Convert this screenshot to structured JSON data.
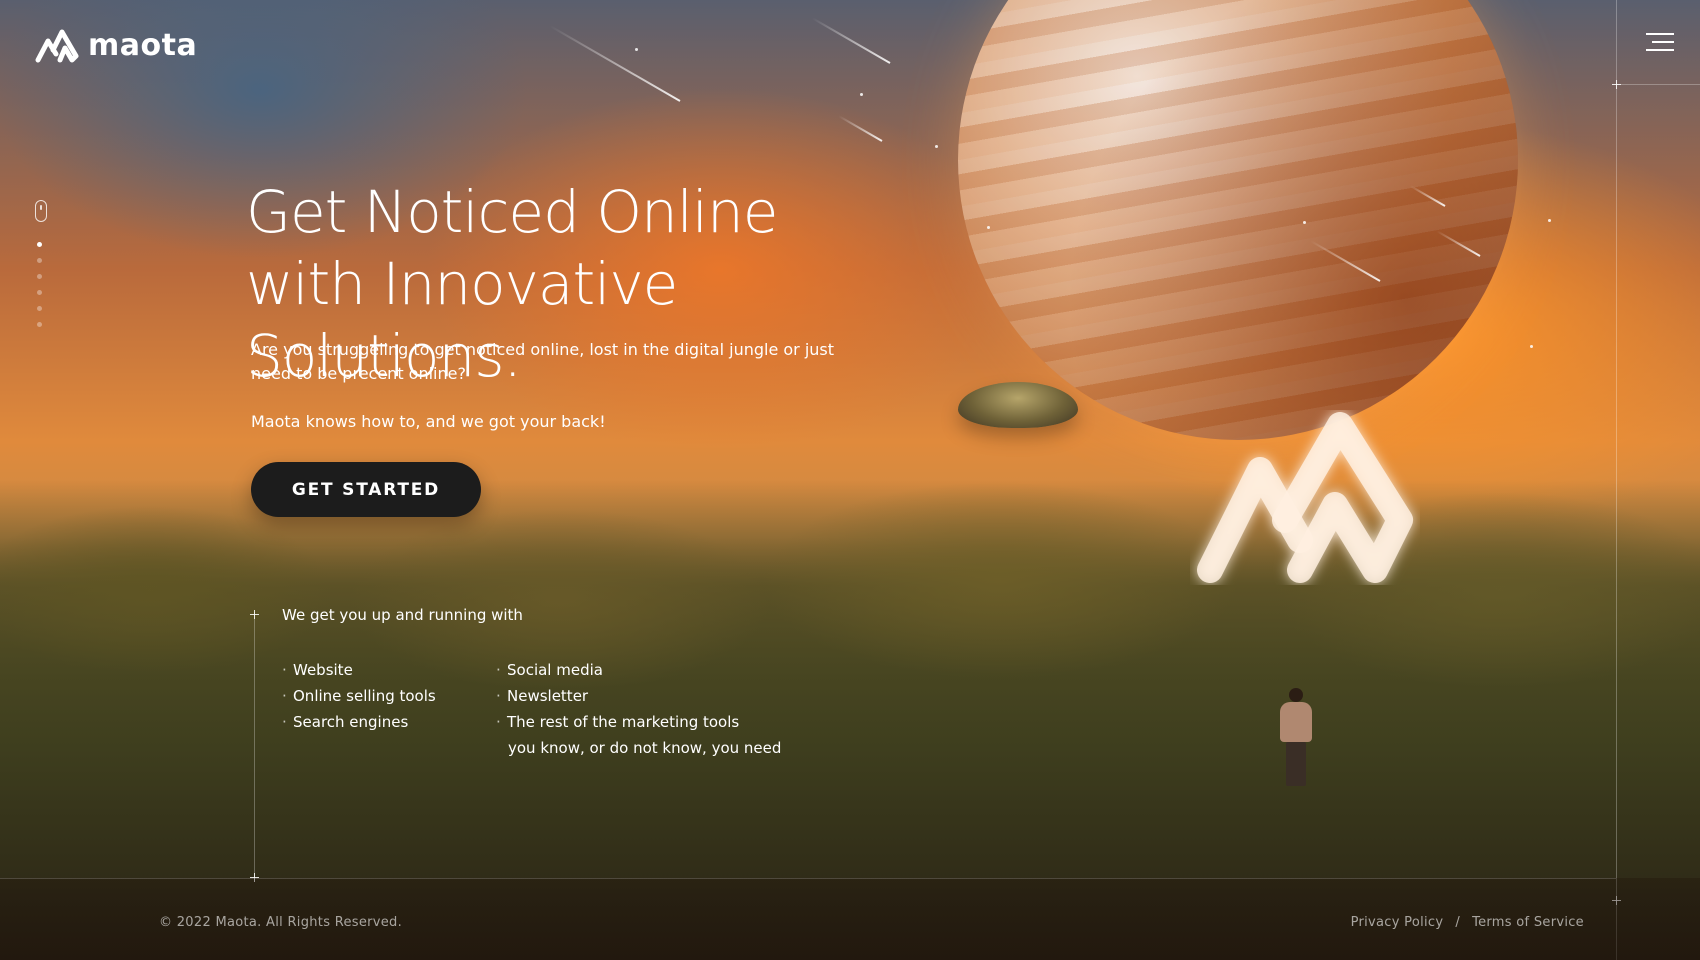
{
  "brand": {
    "name": "maota",
    "logo_icon": "maota-logo-mark"
  },
  "header": {
    "menu_icon": "hamburger-menu-icon"
  },
  "hero": {
    "title_line1": "Get Noticed Online",
    "title_line2": "with Innovative Solutions.",
    "description": "Are you struggeling to get noticed online, lost in the digital jungle or just need to be precent online?",
    "tagline": "Maota knows how to, and we got your back!",
    "cta_label": "GET STARTED"
  },
  "services": {
    "heading": "We get you up and running with",
    "left": [
      "Website",
      "Online selling tools",
      "Search engines"
    ],
    "right": [
      "Social media",
      "Newsletter",
      "The rest of the marketing tools"
    ],
    "right_continuation": "you know, or do not know, you need"
  },
  "slide_nav": {
    "total": 6,
    "active_index": 0
  },
  "footer": {
    "copyright": "© 2022 Maota. All Rights Reserved.",
    "privacy_label": "Privacy Policy",
    "separator": "/",
    "terms_label": "Terms of Service"
  },
  "colors": {
    "cta_background": "#1c1c1c",
    "text": "#ffffff"
  }
}
